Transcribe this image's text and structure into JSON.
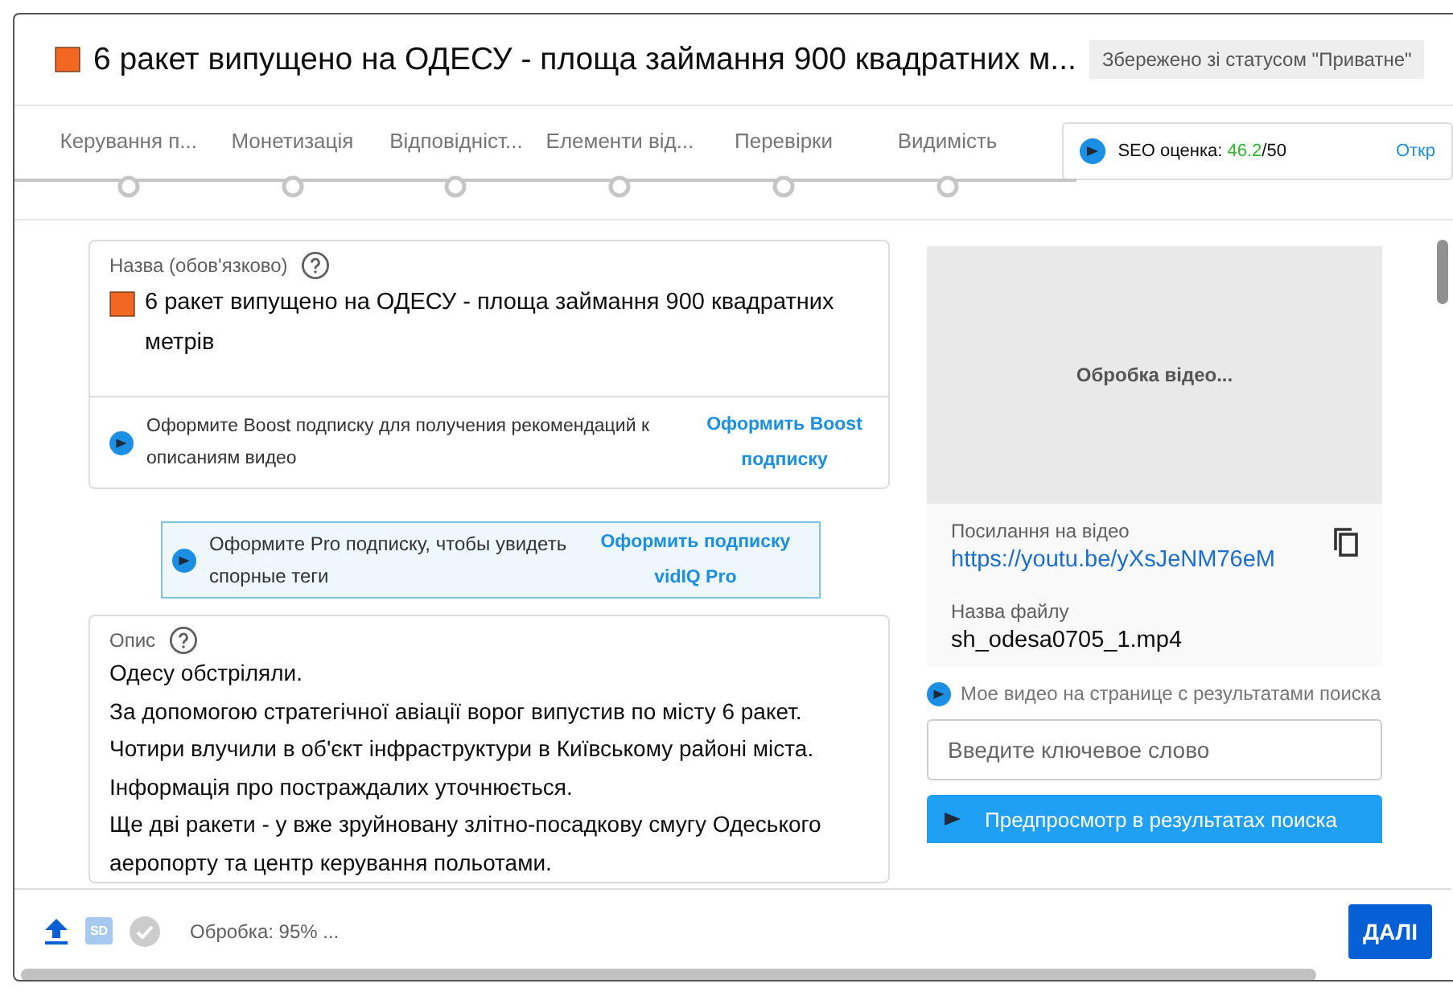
{
  "dialog": {
    "title": "6 ракет випущено на ОДЕСУ - площа займання 900 квадратних м...",
    "save_status": "Збережено зі статусом \"Приватне\""
  },
  "steps": [
    {
      "label": "Керування п..."
    },
    {
      "label": "Монетизація"
    },
    {
      "label": "Відповідніст..."
    },
    {
      "label": "Елементи від..."
    },
    {
      "label": "Перевірки"
    },
    {
      "label": "Видимість"
    }
  ],
  "seo": {
    "label": "SEO оценка:",
    "score": "46.2",
    "total": "/50",
    "link": "Откр"
  },
  "title_field": {
    "label": "Назва (обов'язково)",
    "value": "6 ракет випущено на ОДЕСУ - площа займання  900 квадратних метрів"
  },
  "boost_hint": {
    "text": "Оформите Boost подписку для получения рекомендаций к описаниям видео",
    "link": "Оформить Boost подписку"
  },
  "pro_hint": {
    "text": "Оформите Pro подписку, чтобы увидеть спорные теги",
    "link": "Оформить подписку vidIQ Pro"
  },
  "description_field": {
    "label": "Опис",
    "lines": [
      "Одесу  обстріляли.",
      "За допомогою стратегічної авіації ворог випустив по місту 6 ракет.",
      "Чотири влучили в об'єкт інфраструктури в Київському районі міста.",
      "Інформація про постраждалих уточнюється.",
      "Ще дві ракети - у вже зруйновану злітно-посадкову смугу Одеського",
      "аеропорту та центр керування польотами."
    ]
  },
  "preview": {
    "status": "Обробка відео...",
    "link_label": "Посилання на відео",
    "link": "https://youtu.be/yXsJeNM76eM",
    "file_label": "Назва файлу",
    "file": "sh_odesa0705_1.mp4"
  },
  "search_preview": {
    "hint": "Мое видео на странице с результатами поиска",
    "placeholder": "Введите ключевое слово",
    "button": "Предпросмотр в результатах поиска"
  },
  "footer": {
    "badge": "SD",
    "status": "Обробка: 95% ...",
    "next": "ДАЛІ"
  }
}
